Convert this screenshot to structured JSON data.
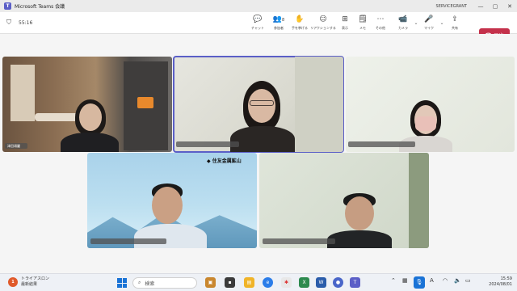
{
  "window": {
    "title": "Microsoft Teams 会議",
    "tenant": "SERVICEGRANT",
    "minimize": "—",
    "maximize": "▢",
    "close": "✕"
  },
  "meeting": {
    "timer": "55:16",
    "toolbar": [
      {
        "icon": "chat-icon",
        "glyph": "💬",
        "label": "チャット"
      },
      {
        "icon": "people-icon",
        "glyph": "👥",
        "label": "参加者",
        "count": "8"
      },
      {
        "icon": "raise-hand-icon",
        "glyph": "✋",
        "label": "手を挙げる"
      },
      {
        "icon": "reactions-icon",
        "glyph": "☺",
        "label": "リアクションする"
      },
      {
        "icon": "view-icon",
        "glyph": "⊞",
        "label": "表示"
      },
      {
        "icon": "notes-icon",
        "glyph": "🗒",
        "label": "メモ"
      },
      {
        "icon": "more-icon",
        "glyph": "⋯",
        "label": "その他"
      },
      {
        "icon": "camera-icon",
        "glyph": "📹",
        "label": "カメラ"
      },
      {
        "icon": "mic-icon",
        "glyph": "🎤",
        "label": "マイク"
      },
      {
        "icon": "share-icon",
        "glyph": "⇪",
        "label": "共有"
      }
    ],
    "leave_label": "退出"
  },
  "tiles": {
    "t1_name": "津田頌麗",
    "t4_logo": "住友金属鉱山"
  },
  "taskbar": {
    "weather_badge": "1",
    "weather_title": "トライアスロン",
    "weather_sub": "最新結果",
    "search_placeholder": "検索",
    "ime": "A",
    "time": "15:59",
    "date": "2024/08/01"
  },
  "colors": {
    "accent": "#5b5fc7",
    "leave": "#c4314b",
    "taskbar_blue": "#1a73d6"
  }
}
